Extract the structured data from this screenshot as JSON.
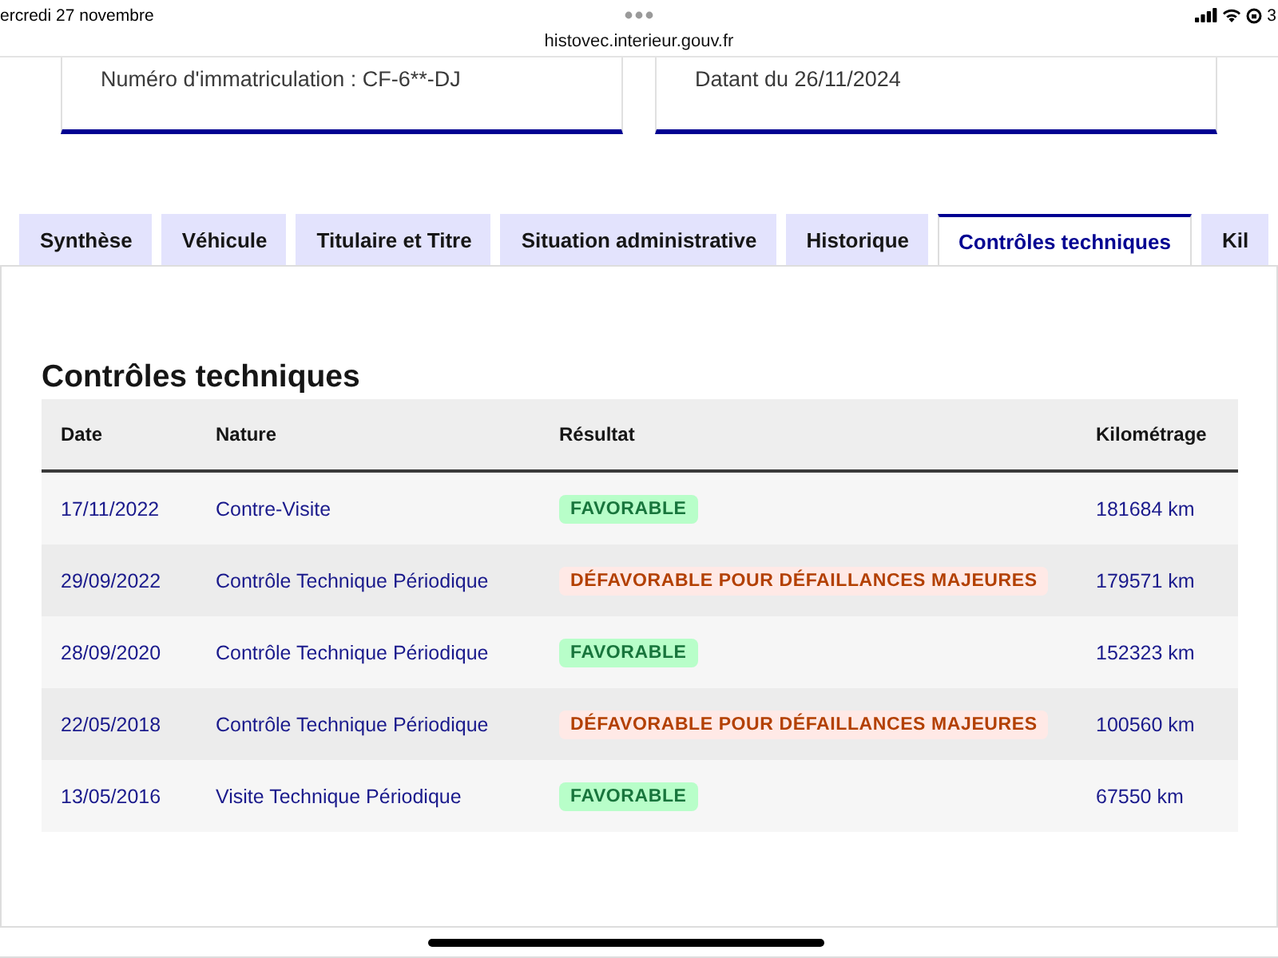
{
  "status_bar": {
    "date": "ercredi 27 novembre",
    "battery_percent": "3"
  },
  "address_bar": {
    "url": "histovec.interieur.gouv.fr"
  },
  "info_cards": [
    {
      "text": "Numéro d'immatriculation : CF-6**-DJ"
    },
    {
      "text": "Datant du 26/11/2024"
    }
  ],
  "tabs": [
    {
      "label": "Synthèse",
      "selected": false
    },
    {
      "label": "Véhicule",
      "selected": false
    },
    {
      "label": "Titulaire et Titre",
      "selected": false
    },
    {
      "label": "Situation administrative",
      "selected": false
    },
    {
      "label": "Historique",
      "selected": false
    },
    {
      "label": "Contrôles techniques",
      "selected": true
    },
    {
      "label": "Kil",
      "selected": false
    }
  ],
  "section": {
    "title": "Contrôles techniques",
    "table": {
      "columns": [
        "Date",
        "Nature",
        "Résultat",
        "Kilométrage"
      ],
      "rows": [
        {
          "date": "17/11/2022",
          "nature": "Contre-Visite",
          "result": {
            "kind": "favorable",
            "label": "FAVORABLE"
          },
          "mileage": "181684 km"
        },
        {
          "date": "29/09/2022",
          "nature": "Contrôle Technique Périodique",
          "result": {
            "kind": "unfavorable",
            "label": "DÉFAVORABLE POUR DÉFAILLANCES MAJEURES"
          },
          "mileage": "179571 km"
        },
        {
          "date": "28/09/2020",
          "nature": "Contrôle Technique Périodique",
          "result": {
            "kind": "favorable",
            "label": "FAVORABLE"
          },
          "mileage": "152323 km"
        },
        {
          "date": "22/05/2018",
          "nature": "Contrôle Technique Périodique",
          "result": {
            "kind": "unfavorable",
            "label": "DÉFAVORABLE POUR DÉFAILLANCES MAJEURES"
          },
          "mileage": "100560 km"
        },
        {
          "date": "13/05/2016",
          "nature": "Visite Technique Périodique",
          "result": {
            "kind": "favorable",
            "label": "FAVORABLE"
          },
          "mileage": "67550 km"
        }
      ]
    }
  }
}
